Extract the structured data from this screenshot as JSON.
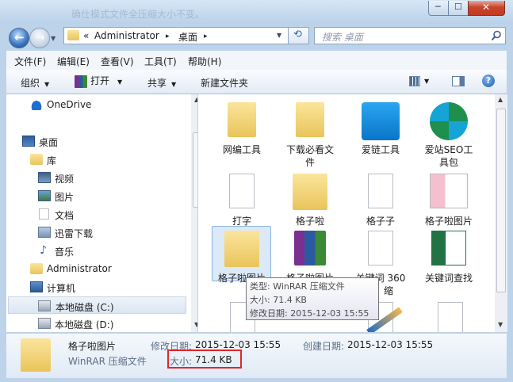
{
  "window": {
    "title_faint": "确仕模式文件全压缩大小不变。",
    "caption": {
      "min": "─",
      "max": "☐",
      "close": "✕"
    }
  },
  "nav": {
    "back_arrow": "←",
    "fwd_arrow": "→",
    "breadcrumb": {
      "overflow": "«",
      "seg1": "Administrator",
      "sep": "▸",
      "seg2": "桌面",
      "sep2": "▸"
    },
    "search_placeholder": "搜索 桌面"
  },
  "menu": [
    "文件(F)",
    "编辑(E)",
    "查看(V)",
    "工具(T)",
    "帮助(H)"
  ],
  "toolbar": {
    "organize": "组织",
    "open": "打开",
    "share": "共享",
    "new_folder": "新建文件夹"
  },
  "sidebar": {
    "onedrive": "OneDrive",
    "desktop": "桌面",
    "library": "库",
    "video": "视频",
    "pictures": "图片",
    "documents": "文档",
    "xunlei": "迅雷下载",
    "music": "音乐",
    "admin": "Administrator",
    "computer": "计算机",
    "drive_c": "本地磁盘 (C:)",
    "drive_d": "本地磁盘 (D:)"
  },
  "items": {
    "wangbian": "网编工具",
    "xiazai_line1": "下载必看文",
    "xiazai_line2": "件",
    "ailian": "爱链工具",
    "aizhan_line1": "爱站SEO工",
    "aizhan_line2": "具包",
    "dazi": "打字",
    "gezila": "格子啦",
    "gezizi": "格子子",
    "gezila_pic": "格子啦图片",
    "gezila_pic_rar": "格子啦图片",
    "keyword360_line1": "关键词 360",
    "keyword360_line2": "缩",
    "keyword_check": "关键词查找"
  },
  "tooltip": {
    "type": "类型: WinRAR 压缩文件",
    "size": "大小: 71.4 KB",
    "modified": "修改日期: 2015-12-03 15:55"
  },
  "details": {
    "name": "格子啦图片",
    "type": "WinRAR 压缩文件",
    "modified_label": "修改日期:",
    "modified_value": "2015-12-03 15:55",
    "created_label": "创建日期:",
    "created_value": "2015-12-03 15:55",
    "size_label": "大小:",
    "size_value": "71.4 KB"
  },
  "colors": {
    "highlight": "#e2252c",
    "selection": "#dbe9f8"
  }
}
